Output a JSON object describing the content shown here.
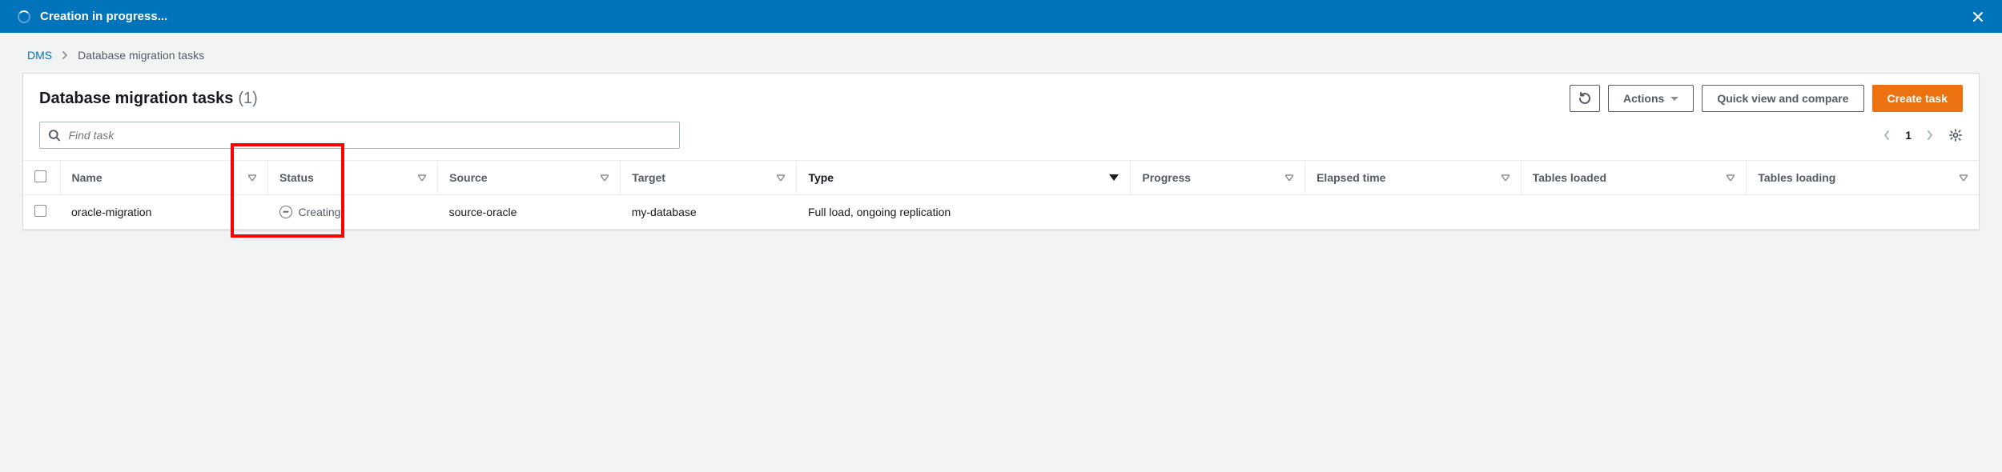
{
  "flash": {
    "title": "Creation in progress..."
  },
  "breadcrumb": {
    "root": "DMS",
    "current": "Database migration tasks"
  },
  "panel": {
    "title": "Database migration tasks",
    "count": "(1)"
  },
  "buttons": {
    "actions": "Actions",
    "quick_view": "Quick view and compare",
    "create": "Create task"
  },
  "search": {
    "placeholder": "Find task"
  },
  "paginator": {
    "page": "1"
  },
  "columns": {
    "name": "Name",
    "status": "Status",
    "source": "Source",
    "target": "Target",
    "type": "Type",
    "progress": "Progress",
    "elapsed": "Elapsed time",
    "tables_loaded": "Tables loaded",
    "tables_loading": "Tables loading"
  },
  "rows": [
    {
      "name": "oracle-migration",
      "status": "Creating",
      "source": "source-oracle",
      "target": "my-database",
      "type": "Full load, ongoing replication",
      "progress": "",
      "elapsed": "",
      "tables_loaded": "",
      "tables_loading": ""
    }
  ]
}
